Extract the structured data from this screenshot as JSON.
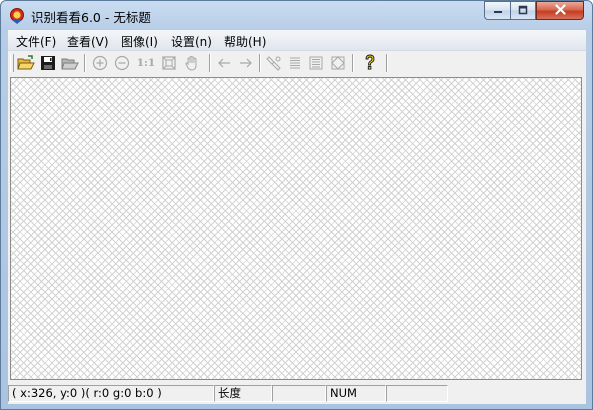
{
  "window": {
    "title": "识别看看6.0 - 无标题",
    "app_icon": "app-logo-icon",
    "controls": {
      "minimize": "minimize-icon",
      "maximize": "maximize-icon",
      "close": "close-icon"
    }
  },
  "menu": {
    "file": "文件(F)",
    "view": "查看(V)",
    "image": "图像(I)",
    "settings": "设置(n)",
    "help": "帮助(H)"
  },
  "toolbar": {
    "buttons": [
      {
        "name": "open-folder-icon",
        "enabled": true
      },
      {
        "name": "save-disk-icon",
        "enabled": true
      },
      {
        "name": "open-recent-icon",
        "enabled": false
      },
      {
        "name": "zoom-in-icon",
        "enabled": false
      },
      {
        "name": "zoom-out-icon",
        "enabled": false
      },
      {
        "name": "actual-size-icon",
        "enabled": false,
        "label": "1:1"
      },
      {
        "name": "fit-window-icon",
        "enabled": false
      },
      {
        "name": "hand-pan-icon",
        "enabled": false
      },
      {
        "name": "back-arrow-icon",
        "enabled": false
      },
      {
        "name": "forward-arrow-icon",
        "enabled": false
      },
      {
        "name": "ocr-tool-icon",
        "enabled": false
      },
      {
        "name": "text-lines-icon",
        "enabled": false
      },
      {
        "name": "text-columns-icon",
        "enabled": false
      },
      {
        "name": "crop-frame-icon",
        "enabled": false
      },
      {
        "name": "help-question-icon",
        "enabled": true
      }
    ]
  },
  "status": {
    "coords": "( x:326, y:0 )( r:0 g:0 b:0 )",
    "length_label": "长度",
    "blank1": "",
    "num": "NUM",
    "blank2": ""
  }
}
